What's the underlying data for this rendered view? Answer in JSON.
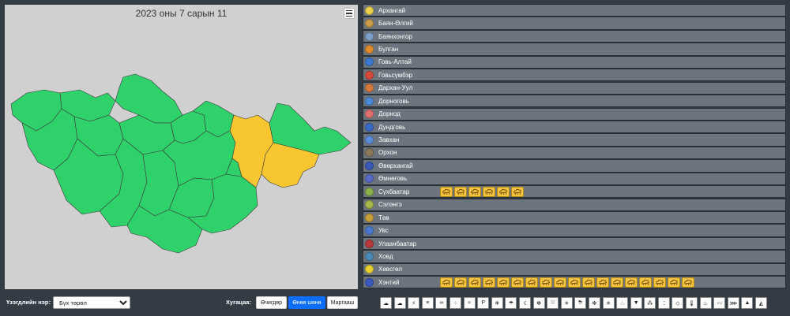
{
  "map": {
    "title": "2023 оны 7 сарын 11",
    "colors": {
      "normal": "#2fd16b",
      "warning": "#f8c630",
      "border": "#3a3a3a"
    }
  },
  "provinces": [
    {
      "name": "Архангай",
      "emblem_color": "#e8d04a",
      "warnings": 0
    },
    {
      "name": "Баян-Өлгий",
      "emblem_color": "#c89a4a",
      "warnings": 0
    },
    {
      "name": "Баянхонгор",
      "emblem_color": "#7fa0c8",
      "warnings": 0
    },
    {
      "name": "Булган",
      "emblem_color": "#e08a2a",
      "warnings": 0
    },
    {
      "name": "Говь-Алтай",
      "emblem_color": "#3a7ad0",
      "warnings": 0
    },
    {
      "name": "Говьсүмбэр",
      "emblem_color": "#d84a3a",
      "warnings": 0
    },
    {
      "name": "Дархан-Уул",
      "emblem_color": "#d87a3a",
      "warnings": 0
    },
    {
      "name": "Дорноговь",
      "emblem_color": "#4a8ad8",
      "warnings": 0
    },
    {
      "name": "Дорнод",
      "emblem_color": "#e07070",
      "warnings": 0
    },
    {
      "name": "Дундговь",
      "emblem_color": "#3a6ac8",
      "warnings": 0
    },
    {
      "name": "Завхан",
      "emblem_color": "#5a8ad8",
      "warnings": 0
    },
    {
      "name": "Орхон",
      "emblem_color": "#8a7a5a",
      "warnings": 0
    },
    {
      "name": "Өвөрхангай",
      "emblem_color": "#3a5ab8",
      "warnings": 0
    },
    {
      "name": "Өмнөговь",
      "emblem_color": "#5a6ac8",
      "warnings": 0
    },
    {
      "name": "Сүхбаатар",
      "emblem_color": "#8ab04a",
      "warnings": 6
    },
    {
      "name": "Сэлэнгэ",
      "emblem_color": "#a8b84a",
      "warnings": 0
    },
    {
      "name": "Төв",
      "emblem_color": "#c8a03a",
      "warnings": 0
    },
    {
      "name": "Увс",
      "emblem_color": "#4a7ad0",
      "warnings": 0
    },
    {
      "name": "Улаанбаатар",
      "emblem_color": "#b83a3a",
      "warnings": 0
    },
    {
      "name": "Ховд",
      "emblem_color": "#4a8ab8",
      "warnings": 0
    },
    {
      "name": "Хөвсгөл",
      "emblem_color": "#e8d030",
      "warnings": 0
    },
    {
      "name": "Хэнтий",
      "emblem_color": "#3a5ac0",
      "warnings": 18
    }
  ],
  "warning_icon": "dust-storm-icon",
  "filter": {
    "label": "Үзэгдлийн нэр:",
    "selected": "Бүх төрөл"
  },
  "period": {
    "label": "Хугацаа:",
    "buttons": [
      {
        "label": "Өчигдөр",
        "active": false
      },
      {
        "label": "Өнөө шөнө",
        "active": true
      },
      {
        "label": "Маргааш",
        "active": false
      }
    ]
  },
  "legend_icons": [
    "cloud-icon",
    "cloud-icon",
    "lightning-icon",
    "fog-icon",
    "haze-icon",
    "dust-icon",
    "wind-icon",
    "parking-icon",
    "cold-icon",
    "rain-icon",
    "thunder-icon",
    "snow-icon",
    "heavy-rain-icon",
    "sun-icon",
    "storm-icon",
    "blizzard-icon",
    "frost-icon",
    "hail-icon",
    "tornado-icon",
    "rain-snow-icon",
    "drizzle-icon",
    "ice-icon",
    "thermometer-icon",
    "heat-icon",
    "flood-icon",
    "sandstorm-icon",
    "fire-icon",
    "avalanche-icon"
  ]
}
